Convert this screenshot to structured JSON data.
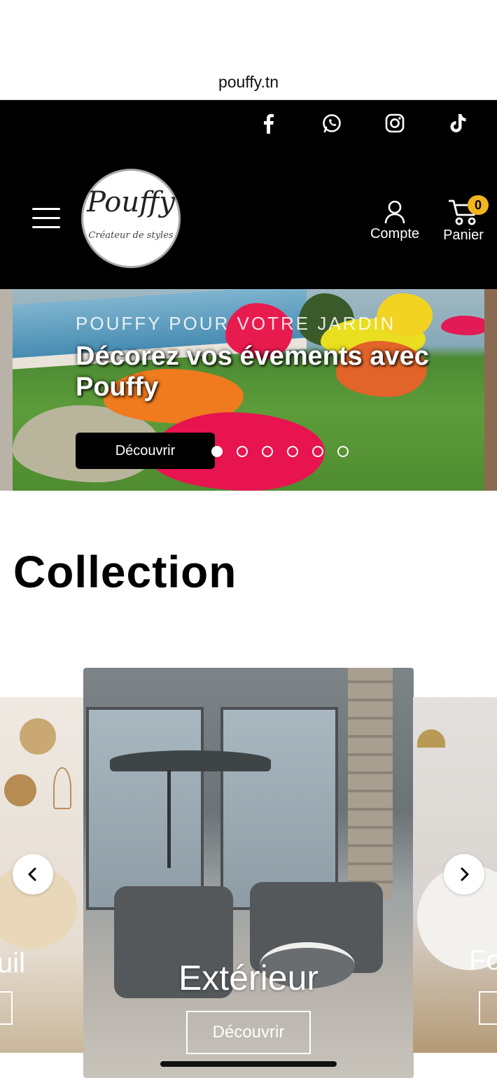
{
  "browser": {
    "url": "pouffy.tn"
  },
  "header": {
    "social": [
      {
        "icon": "facebook-icon"
      },
      {
        "icon": "whatsapp-icon"
      },
      {
        "icon": "instagram-icon"
      },
      {
        "icon": "tiktok-icon"
      }
    ],
    "logo": {
      "text": "Pouffy",
      "tagline": "Créateur de styles"
    },
    "account_label": "Compte",
    "cart_label": "Panier",
    "cart_count": "0",
    "colors": {
      "background": "#000000",
      "badge": "#f2b51e"
    }
  },
  "hero": {
    "kicker": "POUFFY POUR VOTRE JARDIN",
    "title": "Décorez vos évements avec Pouffy",
    "button": "Découvrir",
    "slide_count": 6,
    "active_slide": 0
  },
  "collection": {
    "title": "Collection",
    "cards": [
      {
        "label": "Fauteuil",
        "visible_label": "uil",
        "button": ""
      },
      {
        "label": "Extérieur",
        "button": "Découvrir"
      },
      {
        "label": "Fo",
        "button": ""
      }
    ],
    "prev_icon": "chevron-left-icon",
    "next_icon": "chevron-right-icon"
  }
}
